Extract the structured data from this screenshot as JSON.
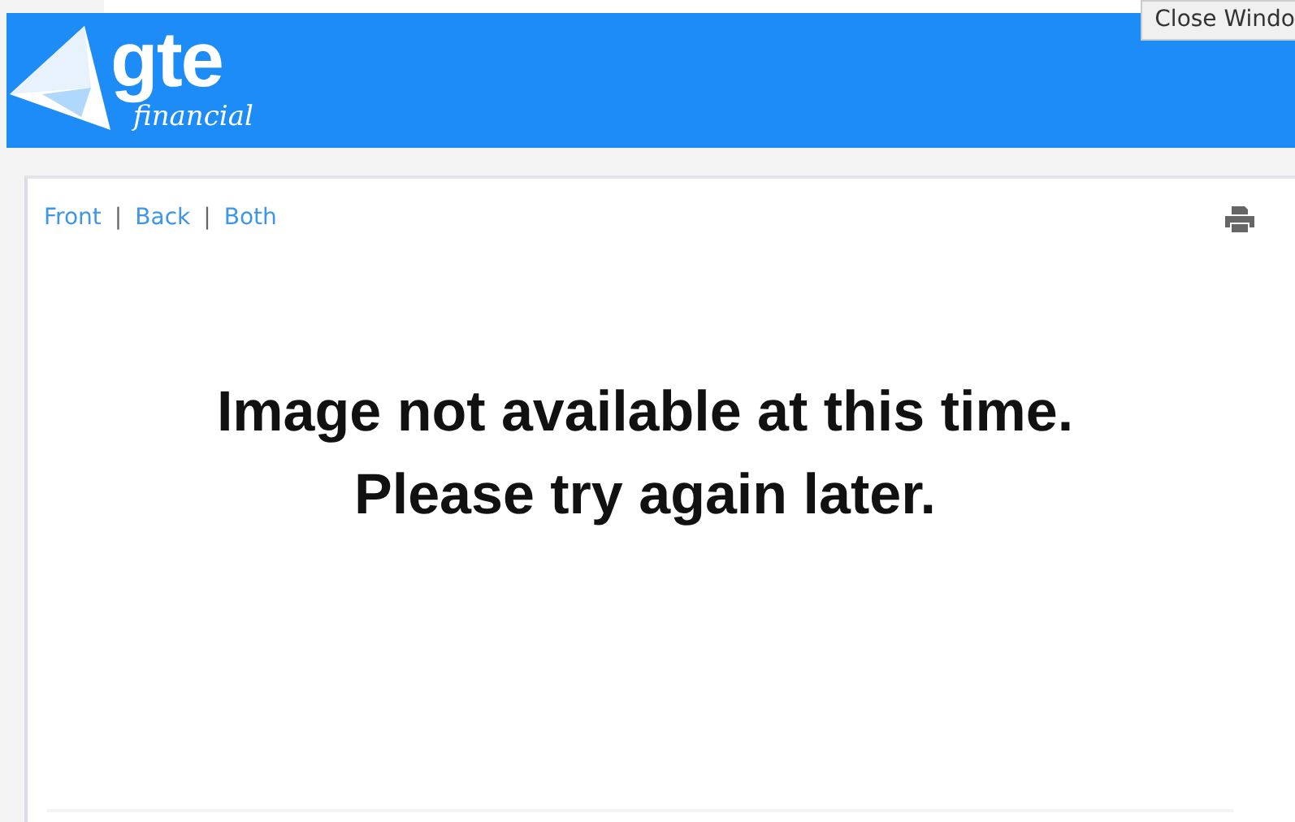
{
  "header": {
    "logo": {
      "name": "gte",
      "tagline": "financial"
    },
    "close_button": "Close Windo"
  },
  "view_links": {
    "separator": "|",
    "links": [
      {
        "label": "Front"
      },
      {
        "label": "Back"
      },
      {
        "label": "Both"
      }
    ]
  },
  "message": [
    "Image not available at this time.",
    "Please try again later."
  ]
}
